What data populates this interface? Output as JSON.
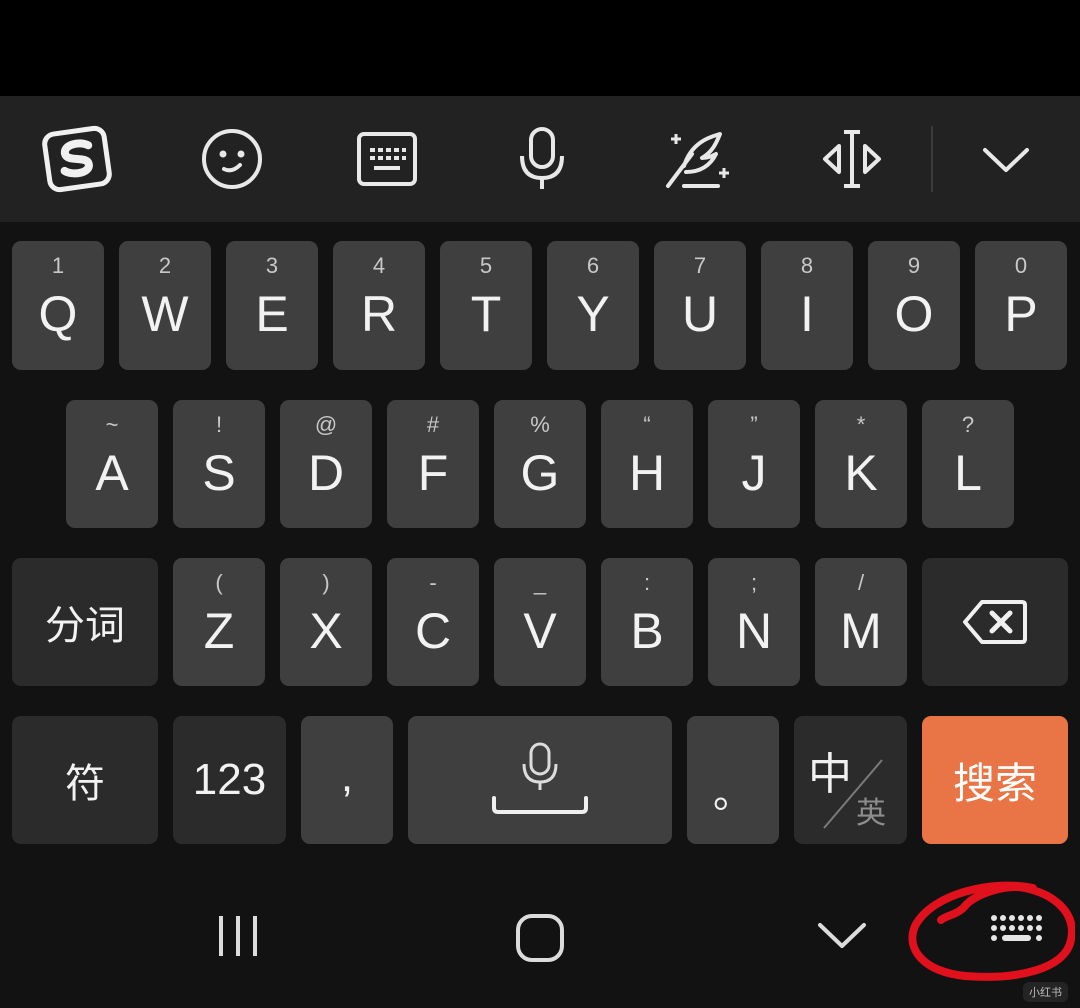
{
  "toolbar": {
    "icons": [
      "sogou-logo-icon",
      "emoji-icon",
      "keyboard-icon",
      "microphone-icon",
      "quill-icon",
      "cursor-move-icon",
      "chevron-down-icon"
    ]
  },
  "rows": {
    "row1": [
      {
        "hint": "1",
        "key": "Q"
      },
      {
        "hint": "2",
        "key": "W"
      },
      {
        "hint": "3",
        "key": "E"
      },
      {
        "hint": "4",
        "key": "R"
      },
      {
        "hint": "5",
        "key": "T"
      },
      {
        "hint": "6",
        "key": "Y"
      },
      {
        "hint": "7",
        "key": "U"
      },
      {
        "hint": "8",
        "key": "I"
      },
      {
        "hint": "9",
        "key": "O"
      },
      {
        "hint": "0",
        "key": "P"
      }
    ],
    "row2": [
      {
        "hint": "~",
        "key": "A"
      },
      {
        "hint": "!",
        "key": "S"
      },
      {
        "hint": "@",
        "key": "D"
      },
      {
        "hint": "#",
        "key": "F"
      },
      {
        "hint": "%",
        "key": "G"
      },
      {
        "hint": "“",
        "key": "H"
      },
      {
        "hint": "”",
        "key": "J"
      },
      {
        "hint": "*",
        "key": "K"
      },
      {
        "hint": "?",
        "key": "L"
      }
    ],
    "row3": [
      {
        "hint": "(",
        "key": "Z"
      },
      {
        "hint": ")",
        "key": "X"
      },
      {
        "hint": "-",
        "key": "C"
      },
      {
        "hint": "_",
        "key": "V"
      },
      {
        "hint": ":",
        "key": "B"
      },
      {
        "hint": ";",
        "key": "N"
      },
      {
        "hint": "/",
        "key": "M"
      }
    ]
  },
  "keys": {
    "segment": "分词",
    "symbols": "符",
    "numbers": "123",
    "comma": ",",
    "period": "。",
    "lang_main": "中",
    "lang_alt": "英",
    "search": "搜索"
  },
  "colors": {
    "accent": "#e97445",
    "key": "#3f3f3f",
    "key_dark": "#2b2b2b",
    "annotation": "#e0101c"
  },
  "navbar": {
    "icons": [
      "recent-apps-icon",
      "home-icon",
      "hide-keyboard-icon",
      "keyboard-switch-icon"
    ]
  },
  "watermark": "小红书"
}
